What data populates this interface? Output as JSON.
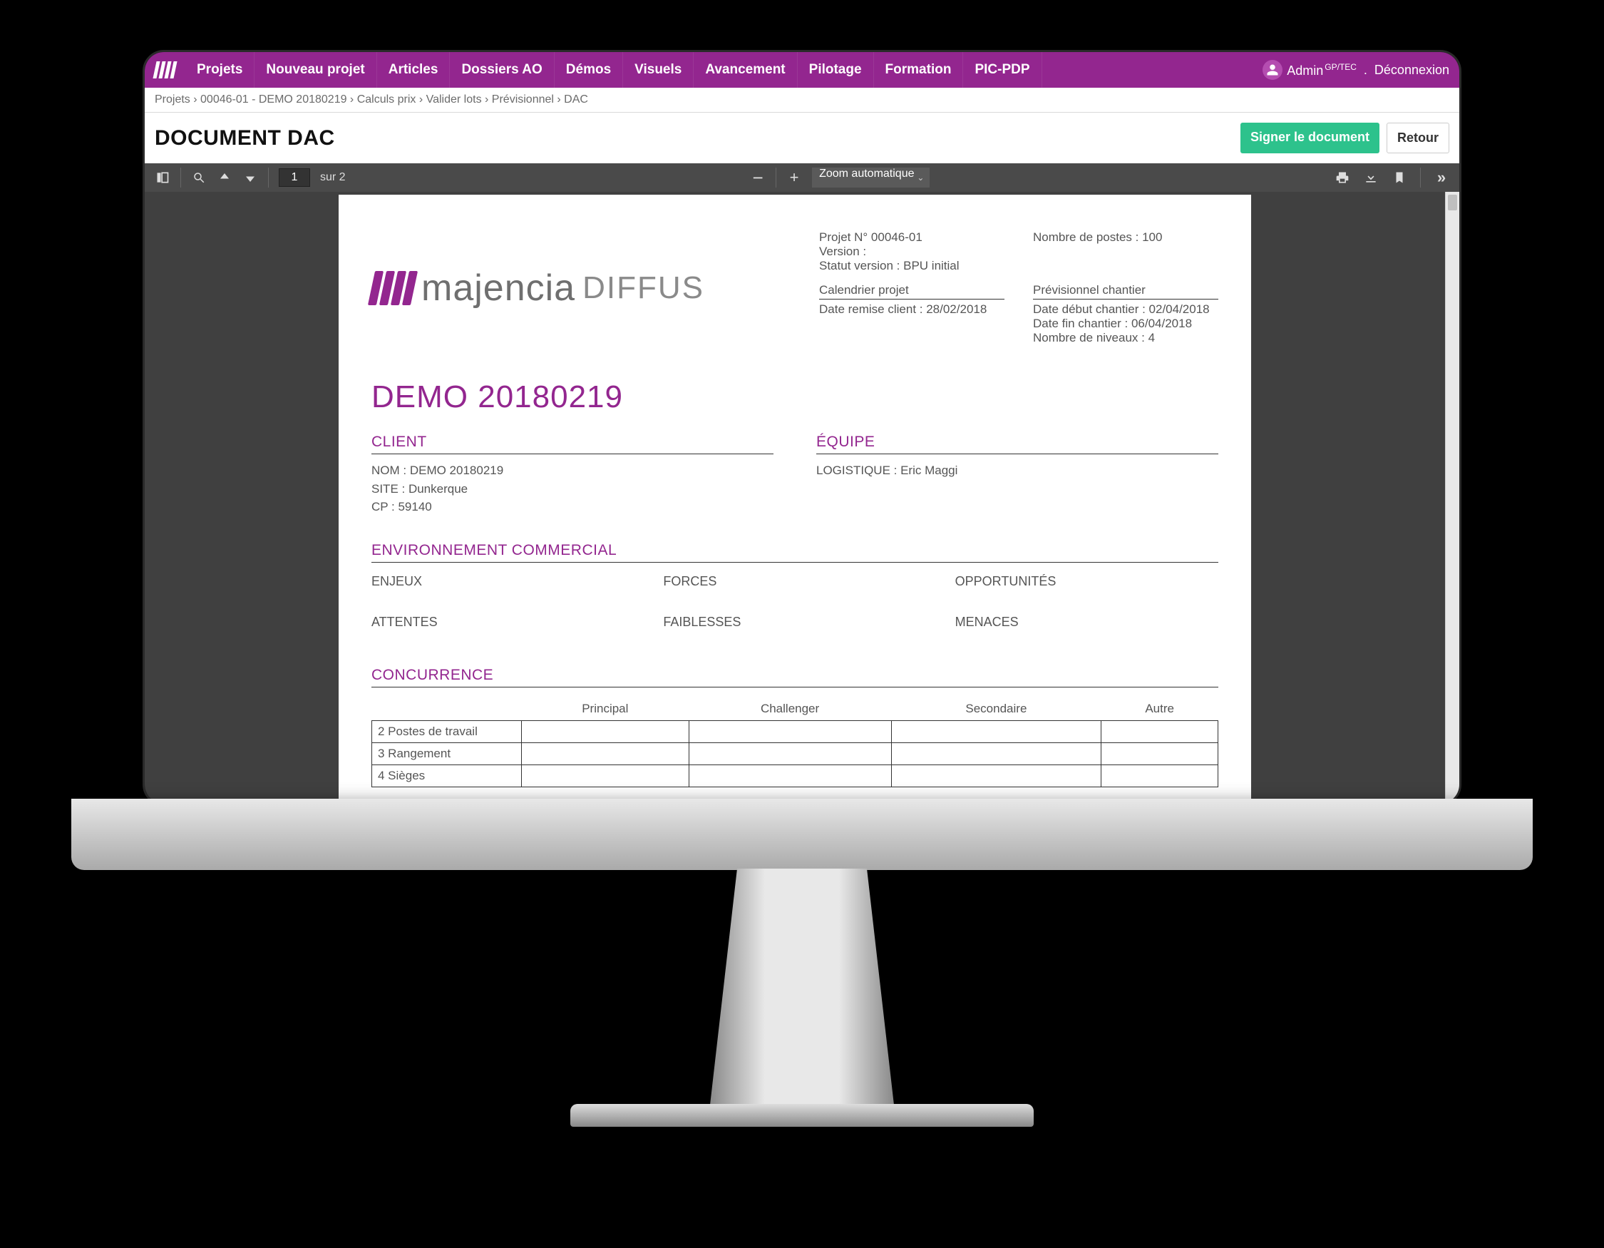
{
  "nav": {
    "items": [
      "Projets",
      "Nouveau projet",
      "Articles",
      "Dossiers AO",
      "Démos",
      "Visuels",
      "Avancement",
      "Pilotage",
      "Formation",
      "PIC-PDP"
    ],
    "user_label": "Admin",
    "user_role": "GP/TEC",
    "logout": "Déconnexion"
  },
  "breadcrumb": "Projets › 00046-01 - DEMO 20180219 › Calculs prix › Valider lots › Prévisionnel › DAC",
  "subheader": {
    "title": "DOCUMENT DAC",
    "sign": "Signer le document",
    "back": "Retour"
  },
  "pdf": {
    "page_current": "1",
    "page_of": "sur 2",
    "zoom": "Zoom automatique"
  },
  "doc": {
    "brand_word": "majencia",
    "brand_suffix": "DIFFUS",
    "meta_left": {
      "l1": "Projet N° 00046-01",
      "l2": "Version :",
      "l3": "Statut version : BPU initial",
      "cal_h": "Calendrier projet",
      "cal_l": "Date remise client : 28/02/2018"
    },
    "meta_right": {
      "l1": "Nombre de postes : 100",
      "prev_h": "Prévisionnel chantier",
      "p1": "Date début chantier : 02/04/2018",
      "p2": "Date fin chantier : 06/04/2018",
      "p3": "Nombre de niveaux : 4"
    },
    "project_name": "DEMO 20180219",
    "client_h": "CLIENT",
    "client": {
      "l1": "NOM : DEMO 20180219",
      "l2": "SITE : Dunkerque",
      "l3": "CP : 59140"
    },
    "team_h": "ÉQUIPE",
    "team_l1": "LOGISTIQUE : Eric Maggi",
    "env_h": "ENVIRONNEMENT COMMERCIAL",
    "swot": {
      "a": "ENJEUX",
      "b": "FORCES",
      "c": "OPPORTUNITÉS",
      "d": "ATTENTES",
      "e": "FAIBLESSES",
      "f": "MENACES"
    },
    "conc_h": "CONCURRENCE",
    "conc_cols": [
      "",
      "Principal",
      "Challenger",
      "Secondaire",
      "Autre"
    ],
    "conc_rows": [
      "2 Postes de travail",
      "3 Rangement",
      "4 Sièges"
    ]
  }
}
